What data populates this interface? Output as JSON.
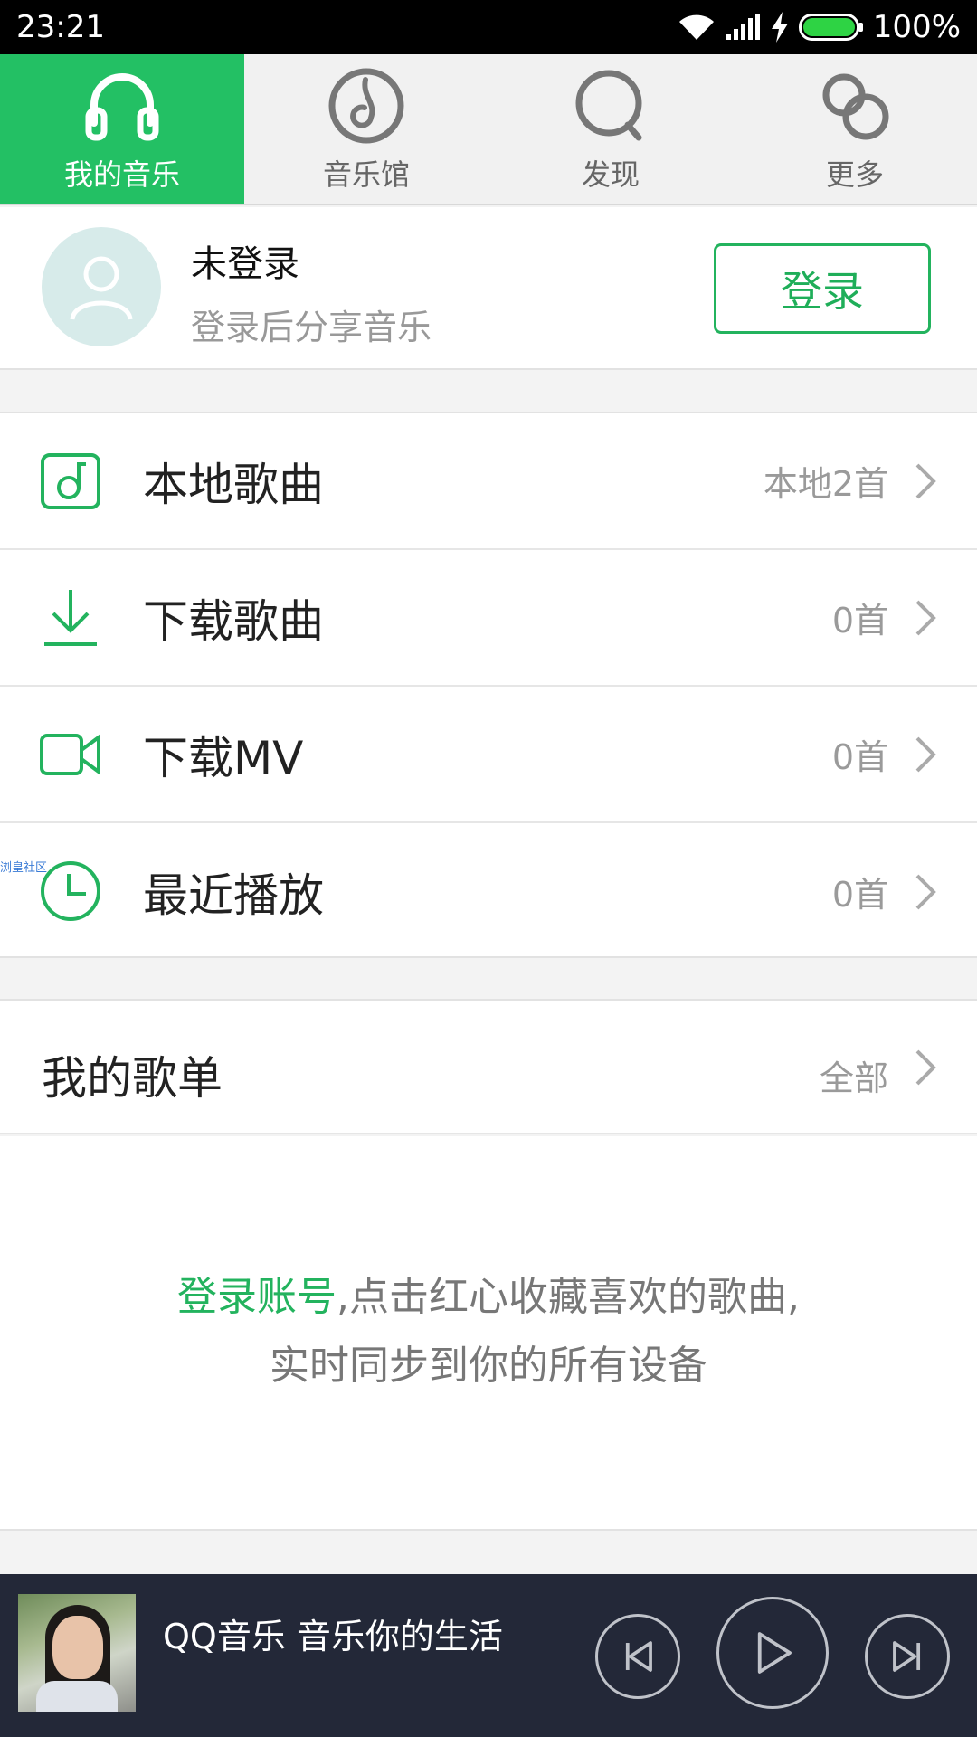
{
  "status_bar": {
    "time": "23:21",
    "battery": "100%",
    "icons": [
      "wifi-icon",
      "signal-icon",
      "charging-icon",
      "battery-icon"
    ]
  },
  "tabs": [
    {
      "label": "我的音乐",
      "icon": "headphones-icon",
      "active": true
    },
    {
      "label": "音乐馆",
      "icon": "music-disc-icon",
      "active": false
    },
    {
      "label": "发现",
      "icon": "search-icon",
      "active": false
    },
    {
      "label": "更多",
      "icon": "more-circles-icon",
      "active": false
    }
  ],
  "profile": {
    "name": "未登录",
    "subtitle": "登录后分享音乐",
    "login_button": "登录"
  },
  "menu": [
    {
      "label": "本地歌曲",
      "count": "本地2首",
      "icon": "music-note-icon"
    },
    {
      "label": "下载歌曲",
      "count": "0首",
      "icon": "download-icon"
    },
    {
      "label": "下载MV",
      "count": "0首",
      "icon": "video-camera-icon"
    },
    {
      "label": "最近播放",
      "count": "0首",
      "icon": "clock-icon"
    }
  ],
  "watermark": "浏皇社区",
  "playlists": {
    "label": "我的歌单",
    "action": "全部"
  },
  "empty_message": {
    "link": "登录账号",
    "line1_rest": ",点击红心收藏喜欢的歌曲,",
    "line2": "实时同步到你的所有设备"
  },
  "player": {
    "title": "QQ音乐 音乐你的生活",
    "controls": [
      "previous-icon",
      "play-icon",
      "next-icon"
    ]
  },
  "colors": {
    "accent": "#23c064",
    "player_bg": "#232838"
  }
}
